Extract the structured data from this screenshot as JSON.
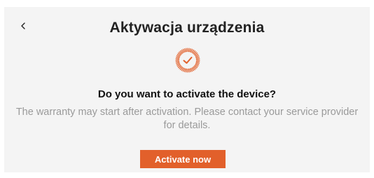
{
  "header": {
    "back_icon": "chevron-left-icon",
    "title": "Aktywacja urządzenia"
  },
  "content": {
    "status_icon": "check-circle-icon",
    "accent_color": "#e2602b",
    "question": "Do you want to activate the device?",
    "description": "The warranty may start after activation. Please contact your service provider for details."
  },
  "actions": {
    "activate_label": "Activate now"
  }
}
